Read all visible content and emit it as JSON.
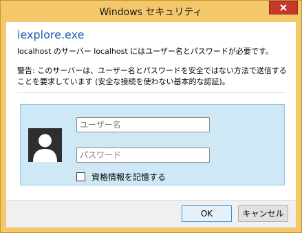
{
  "window": {
    "title": "Windows セキュリティ"
  },
  "dialog": {
    "app_name": "iexplore.exe",
    "message": "localhost のサーバー localhost にはユーザー名とパスワードが必要です。",
    "warning": "警告: このサーバーは、ユーザー名とパスワードを安全ではない方法で送信することを要求しています (安全な接続を使わない基本的な認証)。"
  },
  "credentials": {
    "username_placeholder": "ユーザー名",
    "username_value": "",
    "password_placeholder": "パスワード",
    "password_value": "",
    "remember_label": "資格情報を記憶する",
    "remember_checked": false
  },
  "buttons": {
    "ok": "OK",
    "cancel": "キャンセル"
  },
  "icons": {
    "close": "close-icon",
    "avatar": "user-avatar-icon"
  },
  "colors": {
    "frame": "#f4c76a",
    "close": "#c8392b",
    "app_name": "#1c5fb0",
    "credential_panel": "#cfe8f6"
  }
}
